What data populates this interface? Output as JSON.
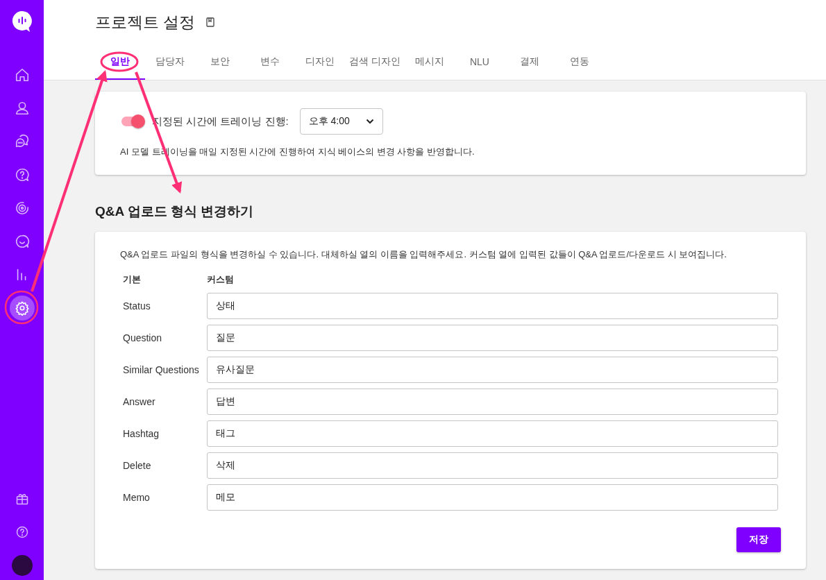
{
  "sidebar": {
    "items": [
      {
        "selected": false
      },
      {
        "selected": false
      },
      {
        "selected": false
      },
      {
        "selected": false
      },
      {
        "selected": false
      },
      {
        "selected": false
      },
      {
        "selected": false
      },
      {
        "selected": true
      }
    ]
  },
  "page": {
    "title": "프로젝트 설정"
  },
  "tabs": [
    {
      "label": "일반",
      "selected": true
    },
    {
      "label": "담당자",
      "selected": false
    },
    {
      "label": "보안",
      "selected": false
    },
    {
      "label": "변수",
      "selected": false
    },
    {
      "label": "디자인",
      "selected": false
    },
    {
      "label": "검색 디자인",
      "selected": false
    },
    {
      "label": "메시지",
      "selected": false
    },
    {
      "label": "NLU",
      "selected": false
    },
    {
      "label": "결제",
      "selected": false
    },
    {
      "label": "연동",
      "selected": false
    }
  ],
  "training": {
    "toggle_on": true,
    "label": "지정된 시간에 트레이닝 진행:",
    "time": "오후 4:00",
    "description": "AI 모델 트레이닝을 매일 지정된 시간에 진행하여 지식 베이스의 변경 사항을 반영합니다."
  },
  "qa_format": {
    "title": "Q&A 업로드 형식 변경하기",
    "description": "Q&A 업로드 파일의 형식을 변경하실 수 있습니다. 대체하실 열의 이름을 입력해주세요. 커스텀 열에 입력된 값들이 Q&A 업로드/다운로드 시 보여집니다.",
    "columns": [
      "기본",
      "커스텀"
    ],
    "rows": [
      {
        "label": "Status",
        "value": "상태"
      },
      {
        "label": "Question",
        "value": "질문"
      },
      {
        "label": "Similar Questions",
        "value": "유사질문"
      },
      {
        "label": "Answer",
        "value": "답변"
      },
      {
        "label": "Hashtag",
        "value": "태그"
      },
      {
        "label": "Delete",
        "value": "삭제"
      },
      {
        "label": "Memo",
        "value": "메모"
      }
    ],
    "save_button": "저장"
  }
}
